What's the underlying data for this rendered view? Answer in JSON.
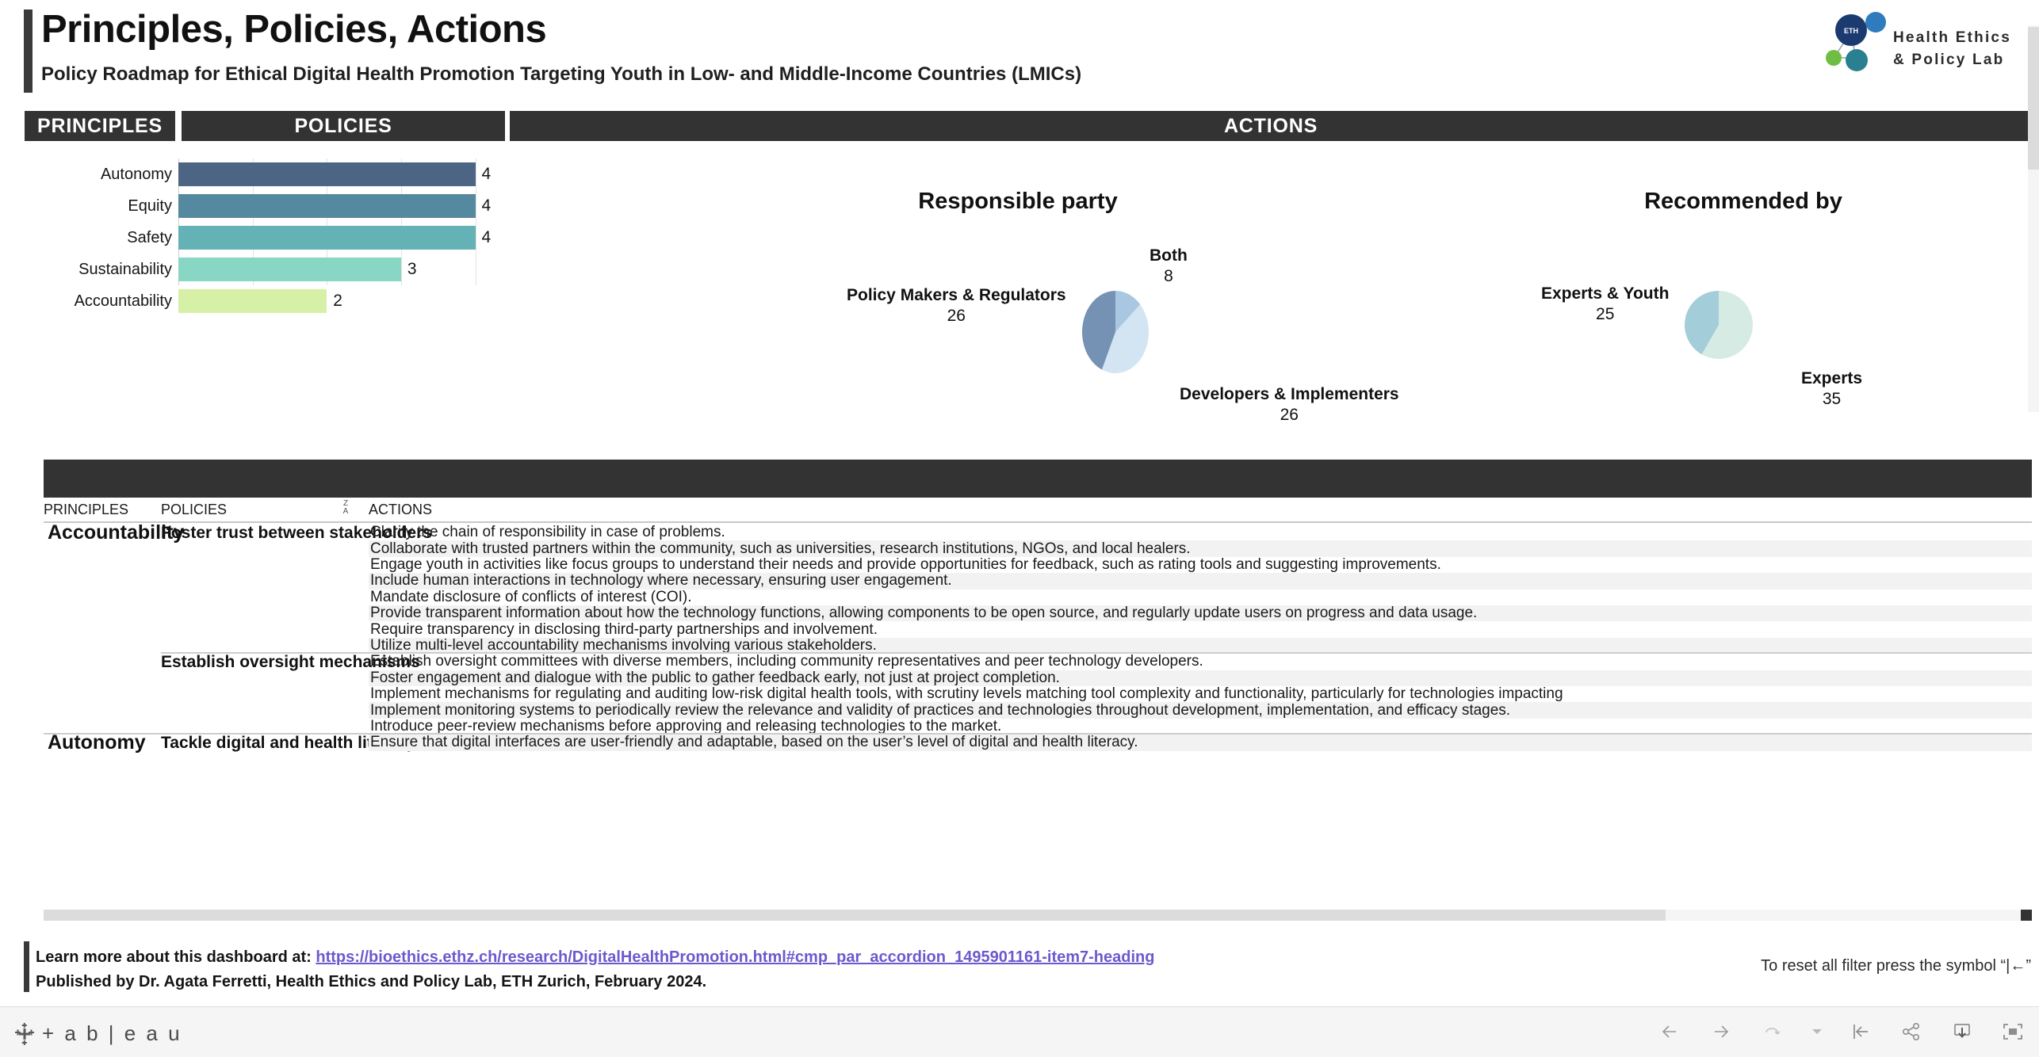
{
  "header": {
    "title": "Principles, Policies, Actions",
    "subtitle": "Policy Roadmap for Ethical Digital Health Promotion Targeting Youth in Low- and Middle-Income Countries (LMICs)",
    "logo": {
      "badge_text": "ETH zürich",
      "line1": "Health Ethics",
      "line2": "& Policy Lab"
    }
  },
  "banners": {
    "principles": "PRINCIPLES",
    "policies": "POLICIES",
    "actions": "ACTIONS"
  },
  "chart_data": [
    {
      "type": "bar",
      "orientation": "horizontal",
      "title": "",
      "xlabel": "",
      "ylabel": "",
      "categories": [
        "Autonomy",
        "Equity",
        "Safety",
        "Sustainability",
        "Accountability"
      ],
      "values": [
        4,
        4,
        4,
        3,
        2
      ],
      "colors": [
        "#4c6585",
        "#5489a0",
        "#64b2b5",
        "#88d6c4",
        "#d7f0a8"
      ],
      "xlim": [
        0,
        4.4
      ],
      "grid": true,
      "gridlines": [
        0,
        1,
        2,
        3,
        4
      ],
      "legend": "none"
    },
    {
      "type": "pie",
      "title": "Responsible party",
      "labels": [
        "Policy Makers & Regulators",
        "Developers & Implementers",
        "Both"
      ],
      "values": [
        26,
        26,
        8
      ],
      "colors": [
        "#7591b4",
        "#d3e5f2",
        "#a9c7e0"
      ],
      "legend": "labels-outside"
    },
    {
      "type": "pie",
      "title": "Recommended by",
      "labels": [
        "Experts",
        "Experts & Youth"
      ],
      "values": [
        35,
        25
      ],
      "colors": [
        "#d6ebe4",
        "#a3cdd8"
      ],
      "legend": "labels-outside"
    }
  ],
  "table": {
    "columns": [
      "PRINCIPLES",
      "POLICIES",
      "ACTIONS"
    ],
    "sort_icon": "sort-za-icon",
    "groups": [
      {
        "principle": "Accountability",
        "policies": [
          {
            "policy": "Foster trust between stakeholders",
            "actions": [
              "Clarify the chain of responsibility in case of problems.",
              "Collaborate with trusted partners within the community, such as universities, research institutions, NGOs, and local healers.",
              "Engage youth in activities like focus groups to understand their needs and provide opportunities for feedback, such as rating tools and suggesting improvements.",
              "Include human interactions in technology where necessary, ensuring user engagement.",
              "Mandate disclosure of conflicts of interest (COI).",
              "Provide transparent information about how the technology functions, allowing components to be open source, and regularly update users on progress and data usage.",
              "Require transparency in disclosing third-party partnerships and involvement.",
              "Utilize multi-level accountability mechanisms involving various stakeholders."
            ]
          },
          {
            "policy": "Establish oversight mechanisms",
            "actions": [
              "Establish oversight committees with diverse members, including community representatives and peer technology developers.",
              "Foster engagement and dialogue with the public to gather feedback early, not just at project completion.",
              "Implement mechanisms for regulating and auditing low-risk digital health tools, with scrutiny levels matching tool complexity and functionality, particularly for technologies impacting",
              "Implement monitoring systems to periodically review the relevance and validity of practices and technologies throughout development, implementation, and efficacy stages.",
              "Introduce peer-review mechanisms before approving and releasing technologies to the market."
            ]
          }
        ]
      },
      {
        "principle": "Autonomy",
        "policies": [
          {
            "policy": "Tackle digital and health literacy",
            "actions": [
              "Ensure that digital interfaces are user-friendly and adaptable, based on the user’s level of digital and health literacy."
            ]
          }
        ]
      }
    ]
  },
  "footer": {
    "line1_prefix": "Learn more about this dashboard at: ",
    "link": "https://bioethics.ethz.ch/research/DigitalHealthPromotion.html#cmp_par_accordion_1495901161-item7-heading",
    "line2": "Published by Dr. Agata Ferretti, Health Ethics and Policy Lab, ETH Zurich, February 2024.",
    "reset_hint": "To reset all filter press the symbol “|←”"
  },
  "tableau_bar": {
    "brand": "+ a b | e a u",
    "icons": [
      "back-arrow-icon",
      "forward-arrow-icon",
      "revert-icon",
      "dropdown-caret-icon",
      "reset-icon",
      "share-icon",
      "download-icon",
      "fullscreen-icon"
    ]
  }
}
